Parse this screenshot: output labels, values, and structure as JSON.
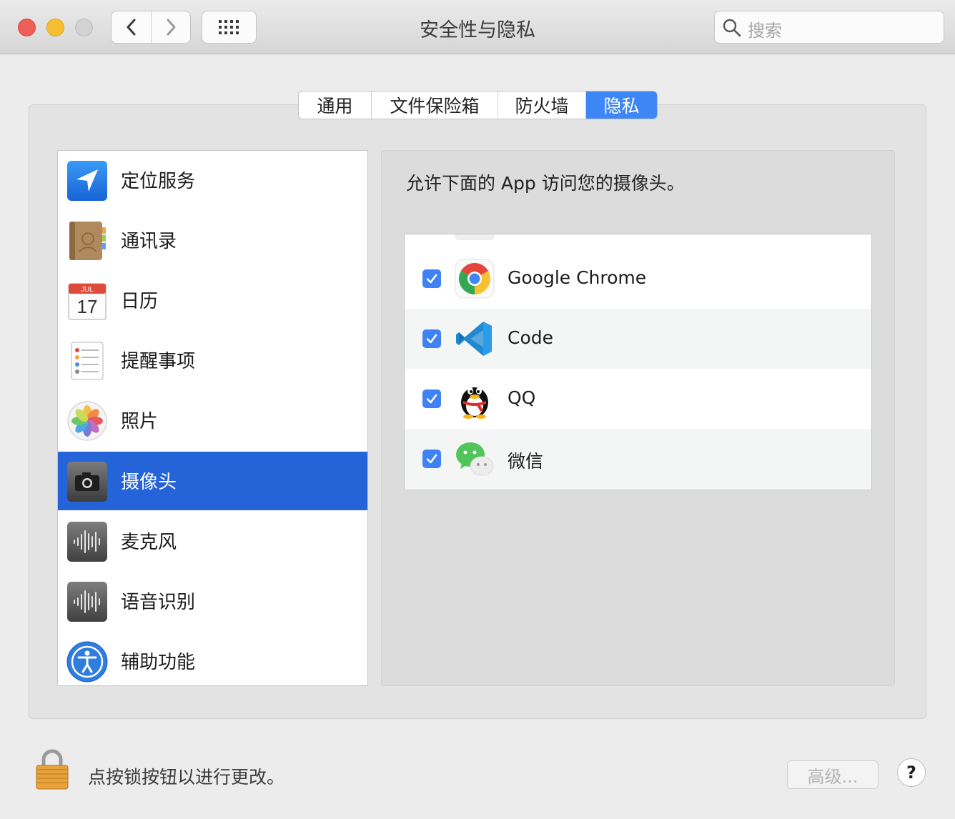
{
  "window": {
    "title": "安全性与隐私"
  },
  "search": {
    "placeholder": "搜索"
  },
  "tabs": [
    {
      "label": "通用"
    },
    {
      "label": "文件保险箱"
    },
    {
      "label": "防火墙"
    },
    {
      "label": "隐私",
      "active": true
    }
  ],
  "sidebar": {
    "items": [
      {
        "label": "定位服务",
        "icon": "location-arrow-icon"
      },
      {
        "label": "通讯录",
        "icon": "contacts-book-icon"
      },
      {
        "label": "日历",
        "icon": "calendar-icon",
        "month": "JUL",
        "day": "17"
      },
      {
        "label": "提醒事项",
        "icon": "reminders-icon"
      },
      {
        "label": "照片",
        "icon": "photos-icon"
      },
      {
        "label": "摄像头",
        "icon": "camera-icon",
        "selected": true
      },
      {
        "label": "麦克风",
        "icon": "microphone-waveform-icon"
      },
      {
        "label": "语音识别",
        "icon": "speech-waveform-icon"
      },
      {
        "label": "辅助功能",
        "icon": "accessibility-icon"
      }
    ]
  },
  "main": {
    "heading": "允许下面的 App 访问您的摄像头。",
    "apps": [
      {
        "name": "Google Chrome",
        "checked": true,
        "icon": "chrome-icon"
      },
      {
        "name": "Code",
        "checked": true,
        "icon": "vscode-icon"
      },
      {
        "name": "QQ",
        "checked": true,
        "icon": "qq-penguin-icon"
      },
      {
        "name": "微信",
        "checked": true,
        "icon": "wechat-icon"
      }
    ]
  },
  "footer": {
    "lock_text": "点按锁按钮以进行更改。",
    "advanced_label": "高级...",
    "help_label": "?"
  },
  "colors": {
    "accent": "#3d86f5",
    "selection": "#2563d9",
    "checkbox": "#3f82f4"
  }
}
